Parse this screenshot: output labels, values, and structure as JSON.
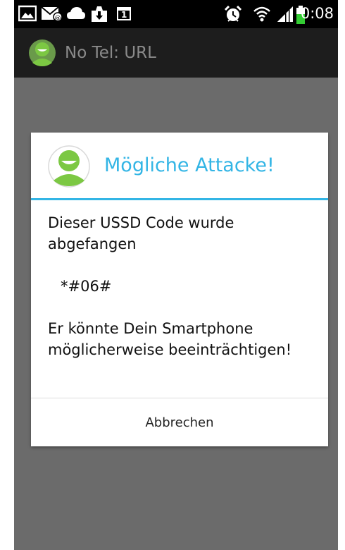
{
  "status_bar": {
    "time": "0:08",
    "icons": [
      "gallery-icon",
      "missed-message-icon",
      "cloud-icon",
      "download-icon",
      "calendar-icon",
      "alarm-icon",
      "wifi-icon",
      "signal-icon",
      "battery-icon"
    ],
    "calendar_day": "1",
    "battery_color": "#33cc33"
  },
  "action_bar": {
    "title": "No Tel: URL"
  },
  "dialog": {
    "title": "Mögliche Attacke!",
    "message_line1": "Dieser USSD Code wurde abgefangen",
    "code": "*#06#",
    "message_line2": "Er könnte Dein Smartphone möglicherweise beeinträchtigen!",
    "cancel_label": "Abbrechen",
    "accent_color": "#33b5e5",
    "logo_color": "#7cc843"
  }
}
